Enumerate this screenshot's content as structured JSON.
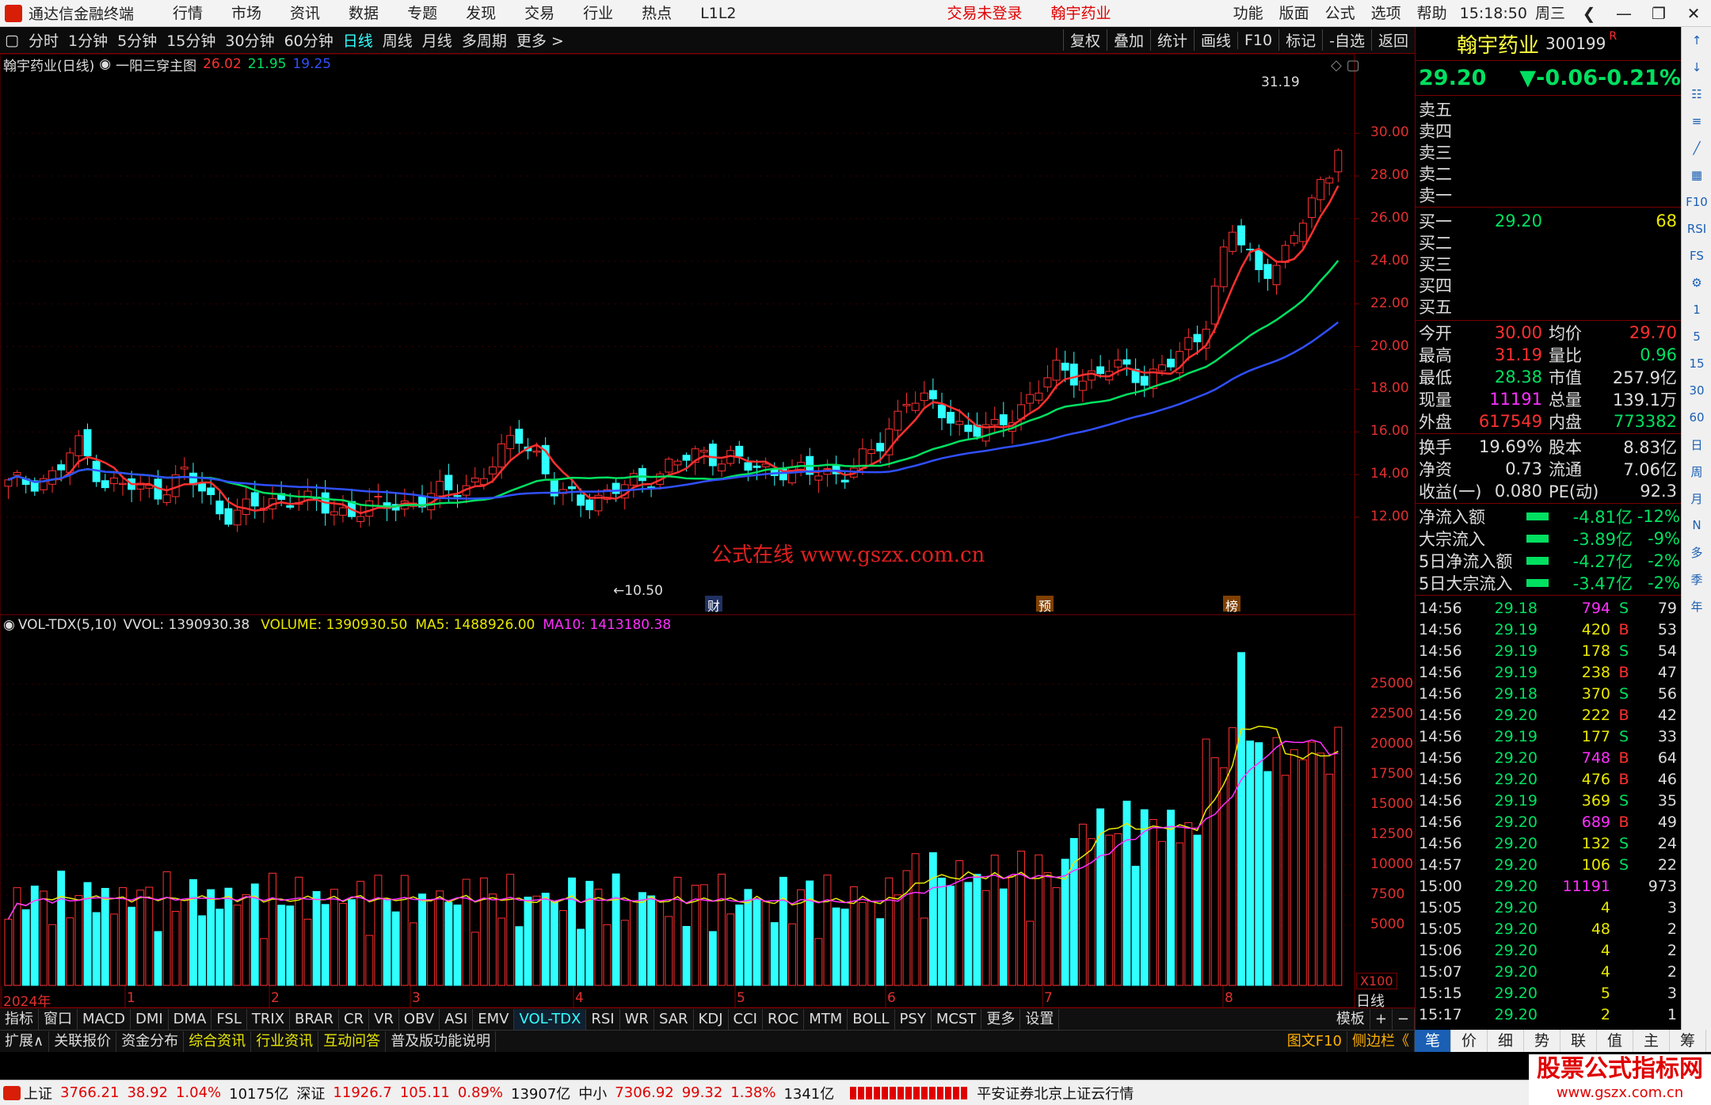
{
  "menubar": {
    "app_title": "通达信金融终端",
    "menus": [
      "行情",
      "市场",
      "资讯",
      "数据",
      "专题",
      "发现",
      "交易",
      "行业",
      "热点",
      "L1L2"
    ],
    "notice": [
      "交易未登录",
      "翰宇药业"
    ],
    "right_menus": [
      "功能",
      "版面",
      "公式",
      "选项",
      "帮助"
    ],
    "time": "15:18:50",
    "weekday": "周三"
  },
  "toolbar": {
    "periods": [
      "分时",
      "1分钟",
      "5分钟",
      "15分钟",
      "30分钟",
      "60分钟",
      "日线",
      "周线",
      "月线",
      "多周期",
      "更多 >"
    ],
    "active": "日线",
    "right_buttons": [
      "复权",
      "叠加",
      "统计",
      "画线",
      "F10",
      "标记",
      "-自选",
      "返回"
    ]
  },
  "main_chart": {
    "legend_name": "翰宇药业(日线)",
    "formula": "一阳三穿主图",
    "ma_values": [
      {
        "value": "26.02",
        "color": "#ff3030"
      },
      {
        "value": "21.95",
        "color": "#00e060"
      },
      {
        "value": "19.25",
        "color": "#3050ff"
      }
    ],
    "y_ticks": [
      "30.00",
      "28.00",
      "26.00",
      "24.00",
      "22.00",
      "20.00",
      "18.00",
      "16.00",
      "14.00",
      "12.00"
    ],
    "high_label": "31.19",
    "low_label": "10.50",
    "event_tags": [
      "财",
      "预",
      "榜"
    ],
    "watermark": "公式在线 www.gszx.com.cn"
  },
  "volume_chart": {
    "legend_name": "VOL-TDX(5,10)",
    "vvol": "VVOL: 1390930.38",
    "volume": "VOLUME: 1390930.50",
    "ma5": "MA5: 1488926.00",
    "ma10": "MA10: 1413180.38",
    "y_ticks": [
      "25000",
      "22500",
      "20000",
      "17500",
      "15000",
      "12500",
      "10000",
      "7500",
      "5000"
    ],
    "unit": "X100"
  },
  "x_axis": {
    "labels": [
      "2024年",
      "1",
      "2",
      "3",
      "4",
      "5",
      "6",
      "7",
      "8"
    ],
    "period": "日线"
  },
  "indicator_tabs": [
    "指标",
    "窗口",
    "MACD",
    "DMI",
    "DMA",
    "FSL",
    "TRIX",
    "BRAR",
    "CR",
    "VR",
    "OBV",
    "ASI",
    "EMV",
    "VOL-TDX",
    "RSI",
    "WR",
    "SAR",
    "KDJ",
    "CCI",
    "ROC",
    "MTM",
    "BOLL",
    "PSY",
    "MCST",
    "更多",
    "设置"
  ],
  "indicator_active": "VOL-TDX",
  "indicator_right": [
    "模板",
    "+",
    "−"
  ],
  "bottom_tabs": [
    "扩展∧",
    "关联报价",
    "资金分布",
    "综合资讯",
    "行业资讯",
    "互动问答",
    "普及版功能说明"
  ],
  "bottom_right": [
    "图文F10",
    "侧边栏《"
  ],
  "quote": {
    "name": "翰宇药业",
    "code": "300199",
    "flag": "R",
    "price": "29.20",
    "change": "▼-0.06",
    "change_pct": "-0.21%",
    "sell": [
      {
        "label": "卖五"
      },
      {
        "label": "卖四"
      },
      {
        "label": "卖三"
      },
      {
        "label": "卖二"
      },
      {
        "label": "卖一"
      }
    ],
    "buy": [
      {
        "label": "买一",
        "price": "29.20",
        "vol": "68"
      },
      {
        "label": "买二",
        "price": "",
        "vol": ""
      },
      {
        "label": "买三",
        "price": "",
        "vol": ""
      },
      {
        "label": "买四",
        "price": "",
        "vol": ""
      },
      {
        "label": "买五",
        "price": "",
        "vol": ""
      }
    ],
    "stats": [
      {
        "l1": "今开",
        "v1": "30.00",
        "c1": "red",
        "l2": "均价",
        "v2": "29.70",
        "c2": "red"
      },
      {
        "l1": "最高",
        "v1": "31.19",
        "c1": "red",
        "l2": "量比",
        "v2": "0.96",
        "c2": "green"
      },
      {
        "l1": "最低",
        "v1": "28.38",
        "c1": "green",
        "l2": "市值",
        "v2": "257.9亿",
        "c2": "white"
      },
      {
        "l1": "现量",
        "v1": "11191",
        "c1": "mag",
        "l2": "总量",
        "v2": "139.1万",
        "c2": "white"
      },
      {
        "l1": "外盘",
        "v1": "617549",
        "c1": "red",
        "l2": "内盘",
        "v2": "773382",
        "c2": "green"
      }
    ],
    "stats2": [
      {
        "l1": "换手",
        "v1": "19.69%",
        "l2": "股本",
        "v2": "8.83亿"
      },
      {
        "l1": "净资",
        "v1": "0.73",
        "l2": "流通",
        "v2": "7.06亿"
      },
      {
        "l1": "收益(一)",
        "v1": "0.080",
        "l2": "PE(动)",
        "v2": "92.3"
      }
    ],
    "flows": [
      {
        "label": "净流入额",
        "value": "-4.81亿",
        "pct": "-12%"
      },
      {
        "label": "大宗流入",
        "value": "-3.89亿",
        "pct": "-9%"
      },
      {
        "label": "5日净流入额",
        "value": "-4.27亿",
        "pct": "-2%"
      },
      {
        "label": "5日大宗流入",
        "value": "-3.47亿",
        "pct": "-2%"
      }
    ],
    "ticks": [
      {
        "t": "14:56",
        "p": "29.18",
        "v": "794",
        "vc": "mag",
        "s": "S",
        "n": "79"
      },
      {
        "t": "14:56",
        "p": "29.19",
        "v": "420",
        "vc": "yellow",
        "s": "B",
        "n": "53"
      },
      {
        "t": "14:56",
        "p": "29.19",
        "v": "178",
        "vc": "yellow",
        "s": "S",
        "n": "54"
      },
      {
        "t": "14:56",
        "p": "29.19",
        "v": "238",
        "vc": "yellow",
        "s": "B",
        "n": "47"
      },
      {
        "t": "14:56",
        "p": "29.18",
        "v": "370",
        "vc": "yellow",
        "s": "S",
        "n": "56"
      },
      {
        "t": "14:56",
        "p": "29.20",
        "v": "222",
        "vc": "yellow",
        "s": "B",
        "n": "42"
      },
      {
        "t": "14:56",
        "p": "29.19",
        "v": "177",
        "vc": "yellow",
        "s": "S",
        "n": "33"
      },
      {
        "t": "14:56",
        "p": "29.20",
        "v": "748",
        "vc": "mag",
        "s": "B",
        "n": "64"
      },
      {
        "t": "14:56",
        "p": "29.20",
        "v": "476",
        "vc": "yellow",
        "s": "B",
        "n": "46"
      },
      {
        "t": "14:56",
        "p": "29.19",
        "v": "369",
        "vc": "yellow",
        "s": "S",
        "n": "35"
      },
      {
        "t": "14:56",
        "p": "29.20",
        "v": "689",
        "vc": "mag",
        "s": "B",
        "n": "49"
      },
      {
        "t": "14:56",
        "p": "29.20",
        "v": "132",
        "vc": "yellow",
        "s": "S",
        "n": "24"
      },
      {
        "t": "14:57",
        "p": "29.20",
        "v": "106",
        "vc": "yellow",
        "s": "S",
        "n": "22"
      },
      {
        "t": "15:00",
        "p": "29.20",
        "v": "11191",
        "vc": "mag",
        "s": "",
        "n": "973"
      },
      {
        "t": "15:05",
        "p": "29.20",
        "v": "4",
        "vc": "yellow",
        "s": "",
        "n": "3"
      },
      {
        "t": "15:05",
        "p": "29.20",
        "v": "48",
        "vc": "yellow",
        "s": "",
        "n": "2"
      },
      {
        "t": "15:06",
        "p": "29.20",
        "v": "4",
        "vc": "yellow",
        "s": "",
        "n": "2"
      },
      {
        "t": "15:07",
        "p": "29.20",
        "v": "4",
        "vc": "yellow",
        "s": "",
        "n": "2"
      },
      {
        "t": "15:15",
        "p": "29.20",
        "v": "5",
        "vc": "yellow",
        "s": "",
        "n": "3"
      },
      {
        "t": "15:17",
        "p": "29.20",
        "v": "2",
        "vc": "yellow",
        "s": "",
        "n": "1"
      }
    ]
  },
  "right_tabs": [
    "笔",
    "价",
    "细",
    "势",
    "联",
    "值",
    "主",
    "筹"
  ],
  "right_tab_active": "笔",
  "iconbar": [
    "↑",
    "↓",
    "☷",
    "≡",
    "╱",
    "▦",
    "F10",
    "RSI",
    "FS",
    "⚙",
    "1",
    "5",
    "15",
    "30",
    "60",
    "日",
    "周",
    "月",
    "N",
    "多",
    "季",
    "年"
  ],
  "status": {
    "sh": {
      "name": "上证",
      "val": "3766.21",
      "chg": "38.92",
      "pct": "1.04%",
      "amt": "10175亿"
    },
    "sz": {
      "name": "深证",
      "val": "11926.7",
      "chg": "105.11",
      "pct": "0.89%",
      "amt": "13907亿"
    },
    "zx": {
      "name": "中小",
      "val": "7306.92",
      "chg": "99.32",
      "pct": "1.38%",
      "amt": "1341亿"
    },
    "broker": "平安证券北京上证云行情",
    "logo_text": "股票公式指标网",
    "logo_url": "www.gszx.com.cn"
  }
}
